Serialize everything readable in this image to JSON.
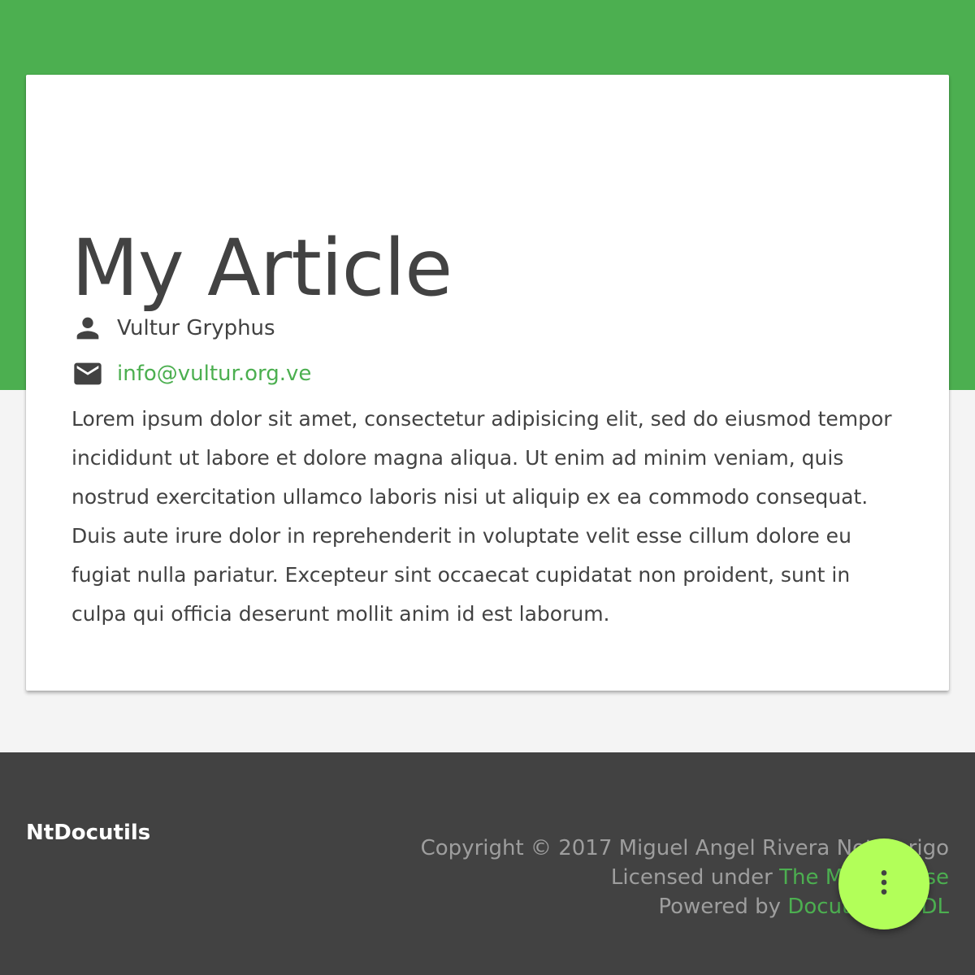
{
  "article": {
    "title": "My Article",
    "author": "Vultur Gryphus",
    "email": "info@vultur.org.ve",
    "body": "Lorem ipsum dolor sit amet, consectetur adipisicing elit, sed do eiusmod tempor incididunt ut labore et dolore magna aliqua. Ut enim ad minim veniam, quis nostrud exercitation ullamco laboris nisi ut aliquip ex ea commodo consequat. Duis aute irure dolor in reprehenderit in voluptate velit esse cillum dolore eu fugiat nulla pariatur. Excepteur sint occaecat cupidatat non proident, sunt in culpa qui officia deserunt mollit anim id est laborum."
  },
  "footer": {
    "brand": "NtDocutils",
    "copyright": "Copyright © 2017 Miguel Angel Rivera Notararigo",
    "license_prefix": "Licensed under ",
    "license_link": "The MIT License",
    "powered_prefix": "Powered by ",
    "powered_link_1": "Docutils",
    "powered_separator": " & ",
    "powered_link_2": "MDL"
  },
  "icons": {
    "author": "person-icon",
    "email": "mail-icon",
    "fab": "more-vert-icon"
  },
  "colors": {
    "primary": "#4caf50",
    "accent": "#b2ff59",
    "text": "#424242",
    "footer_bg": "#424242",
    "footer_text": "#9e9e9e",
    "page_bg": "#f4f4f4"
  }
}
